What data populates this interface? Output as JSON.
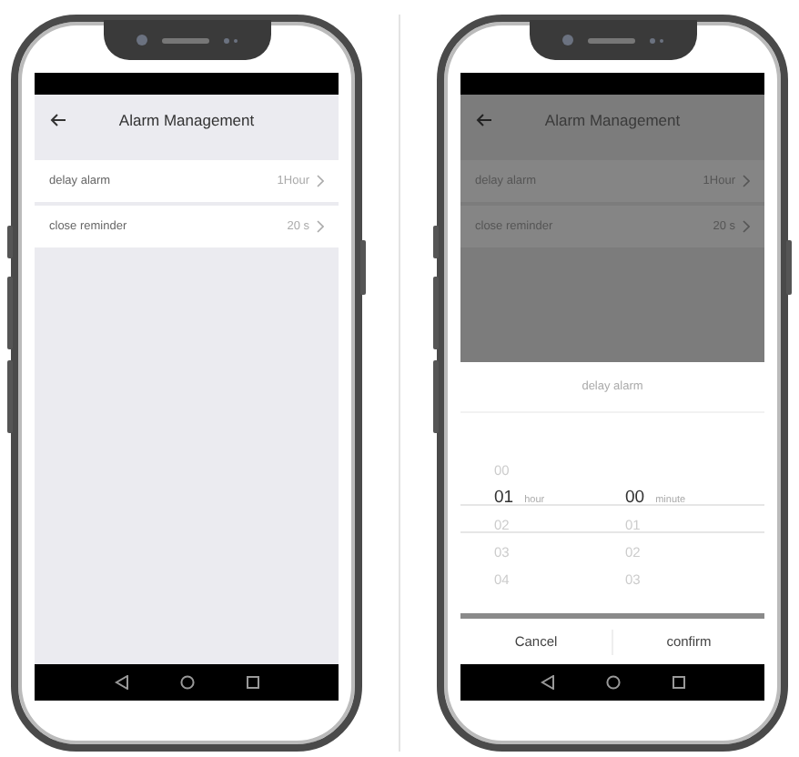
{
  "phones": [
    {
      "kind": "list",
      "dimmed": false,
      "header": {
        "title": "Alarm Management"
      },
      "settings": [
        {
          "label": "delay alarm",
          "value": "1Hour"
        },
        {
          "label": "close reminder",
          "value": "20 s"
        }
      ]
    },
    {
      "kind": "picker",
      "dimmed": true,
      "header": {
        "title": "Alarm Management"
      },
      "settings": [
        {
          "label": "delay alarm",
          "value": "1Hour"
        },
        {
          "label": "close reminder",
          "value": "20 s"
        }
      ],
      "dialog": {
        "title": "delay alarm",
        "columns": [
          {
            "unit": "hour",
            "items": [
              {
                "text": "00",
                "selected": false
              },
              {
                "text": "01",
                "selected": true
              },
              {
                "text": "02",
                "selected": false
              },
              {
                "text": "03",
                "selected": false
              },
              {
                "text": "04",
                "selected": false
              }
            ]
          },
          {
            "unit": "minute",
            "items": [
              {
                "text": "00",
                "selected": true
              },
              {
                "text": "01",
                "selected": false
              },
              {
                "text": "02",
                "selected": false
              },
              {
                "text": "03",
                "selected": false
              }
            ]
          }
        ],
        "buttons": [
          "Cancel",
          "confirm"
        ]
      }
    }
  ]
}
